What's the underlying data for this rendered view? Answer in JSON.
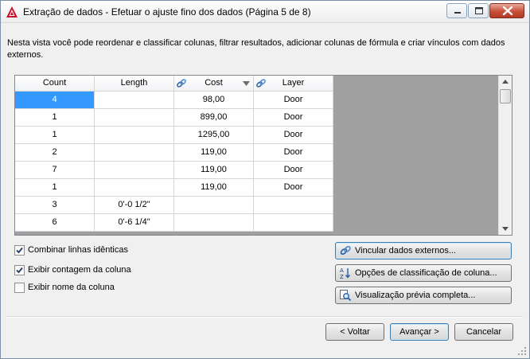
{
  "window": {
    "title": "Extração de dados - Efetuar o ajuste fino dos dados (Página 5 de 8)"
  },
  "description": "Nesta vista você pode reordenar e classificar colunas, filtrar resultados, adicionar colunas de fórmula e criar vínculos com dados externos.",
  "grid": {
    "columns": [
      "Count",
      "Length",
      "Cost",
      "Layer"
    ],
    "rows": [
      [
        "4",
        "",
        "98,00",
        "Door"
      ],
      [
        "1",
        "",
        "899,00",
        "Door"
      ],
      [
        "1",
        "",
        "1295,00",
        "Door"
      ],
      [
        "2",
        "",
        "119,00",
        "Door"
      ],
      [
        "7",
        "",
        "119,00",
        "Door"
      ],
      [
        "1",
        "",
        "119,00",
        "Door"
      ],
      [
        "3",
        "0'-0 1/2\"",
        "",
        ""
      ],
      [
        "6",
        "0'-6 1/4\"",
        "",
        ""
      ]
    ]
  },
  "options": {
    "combine_identical": {
      "label": "Combinar linhas idênticas",
      "checked": true
    },
    "show_count": {
      "label": "Exibir contagem da coluna",
      "checked": true
    },
    "show_name": {
      "label": "Exibir nome da coluna",
      "checked": false
    }
  },
  "actions": {
    "link_external": "Vincular dados externos...",
    "sort_options": "Opções de classificação de coluna...",
    "full_preview": "Visualização prévia completa..."
  },
  "footer": {
    "back": "< Voltar",
    "next": "Avançar >",
    "cancel": "Cancelar"
  }
}
